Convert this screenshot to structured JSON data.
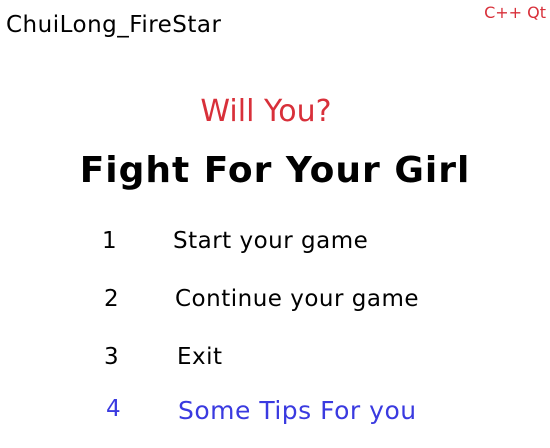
{
  "author": "ChuiLong_FireStar",
  "tech": "C++ Qt",
  "subtitle": "Will You?",
  "title": "Fight For Your Girl",
  "menu": [
    {
      "number": "1",
      "label": "Start your game"
    },
    {
      "number": "2",
      "label": "Continue your game"
    },
    {
      "number": "3",
      "label": "Exit"
    },
    {
      "number": "4",
      "label": "Some Tips For you"
    }
  ],
  "colors": {
    "accent": "#d8303a",
    "highlight": "#3a3ae0",
    "text": "#000000",
    "background": "#ffffff"
  }
}
